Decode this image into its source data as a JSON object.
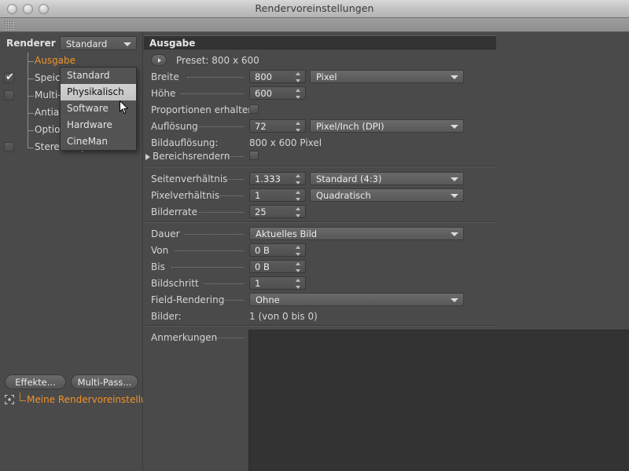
{
  "window": {
    "title": "Rendervoreinstellungen",
    "traffic_lights": [
      "close-button",
      "minimize-button",
      "zoom-button"
    ]
  },
  "sidebar": {
    "renderer_label": "Renderer",
    "renderer_combo": {
      "value": "Standard",
      "open": true,
      "options": [
        "Standard",
        "Physikalisch",
        "Software",
        "Hardware",
        "CineMan"
      ],
      "highlighted": "Physikalisch"
    },
    "tree": [
      {
        "label": "Ausgabe",
        "selected": true,
        "checkbox": "none"
      },
      {
        "label": "Speichern",
        "selected": false,
        "checkbox": "checked"
      },
      {
        "label": "Multi-Pass",
        "selected": false,
        "checkbox": "unchecked"
      },
      {
        "label": "Antialiasing",
        "selected": false,
        "checkbox": "none"
      },
      {
        "label": "Optionen",
        "selected": false,
        "checkbox": "none"
      },
      {
        "label": "Stereoskopie",
        "selected": false,
        "checkbox": "unchecked"
      }
    ],
    "buttons": {
      "effekte": "Effekte...",
      "multipass": "Multi-Pass..."
    },
    "preset_item": {
      "label": "Meine Rendervoreinstellun",
      "icon": "crosshair-icon"
    }
  },
  "content": {
    "group_title": "Ausgabe",
    "preset_row": {
      "button": "expand-preset-button",
      "text": "Preset: 800 x 600"
    },
    "fields": {
      "breite": {
        "label": "Breite",
        "value": "800",
        "unit": "Pixel"
      },
      "hoehe": {
        "label": "Höhe",
        "value": "600"
      },
      "proportionen": {
        "label": "Proportionen erhalten",
        "checked": false
      },
      "aufloesung": {
        "label": "Auflösung",
        "value": "72",
        "unit": "Pixel/Inch (DPI)"
      },
      "bildaufloesung": {
        "label": "Bildauflösung:",
        "value": "800 x 600 Pixel"
      },
      "bereichsrendern": {
        "label": "Bereichsrendern",
        "checked": false
      },
      "seitenverhaeltnis": {
        "label": "Seitenverhältnis",
        "value": "1.333",
        "unit": "Standard (4:3)"
      },
      "pixelverhaeltnis": {
        "label": "Pixelverhältnis",
        "value": "1",
        "unit": "Quadratisch"
      },
      "bilderrate": {
        "label": "Bilderrate",
        "value": "25"
      },
      "dauer": {
        "label": "Dauer",
        "value": "Aktuelles Bild"
      },
      "von": {
        "label": "Von",
        "value": "0 B"
      },
      "bis": {
        "label": "Bis",
        "value": "0 B"
      },
      "bildschritt": {
        "label": "Bildschritt",
        "value": "1"
      },
      "field_rendering": {
        "label": "Field-Rendering",
        "value": "Ohne"
      },
      "bilder": {
        "label": "Bilder:",
        "value": "1 (von 0 bis 0)"
      },
      "anmerkungen": {
        "label": "Anmerkungen",
        "value": ""
      }
    }
  },
  "colors": {
    "panel_bg": "#4a4a4a",
    "group_header_bg": "#333333",
    "accent_selected": "#f0932b",
    "text": "#d5d5d5",
    "field_bg": "#545454"
  }
}
